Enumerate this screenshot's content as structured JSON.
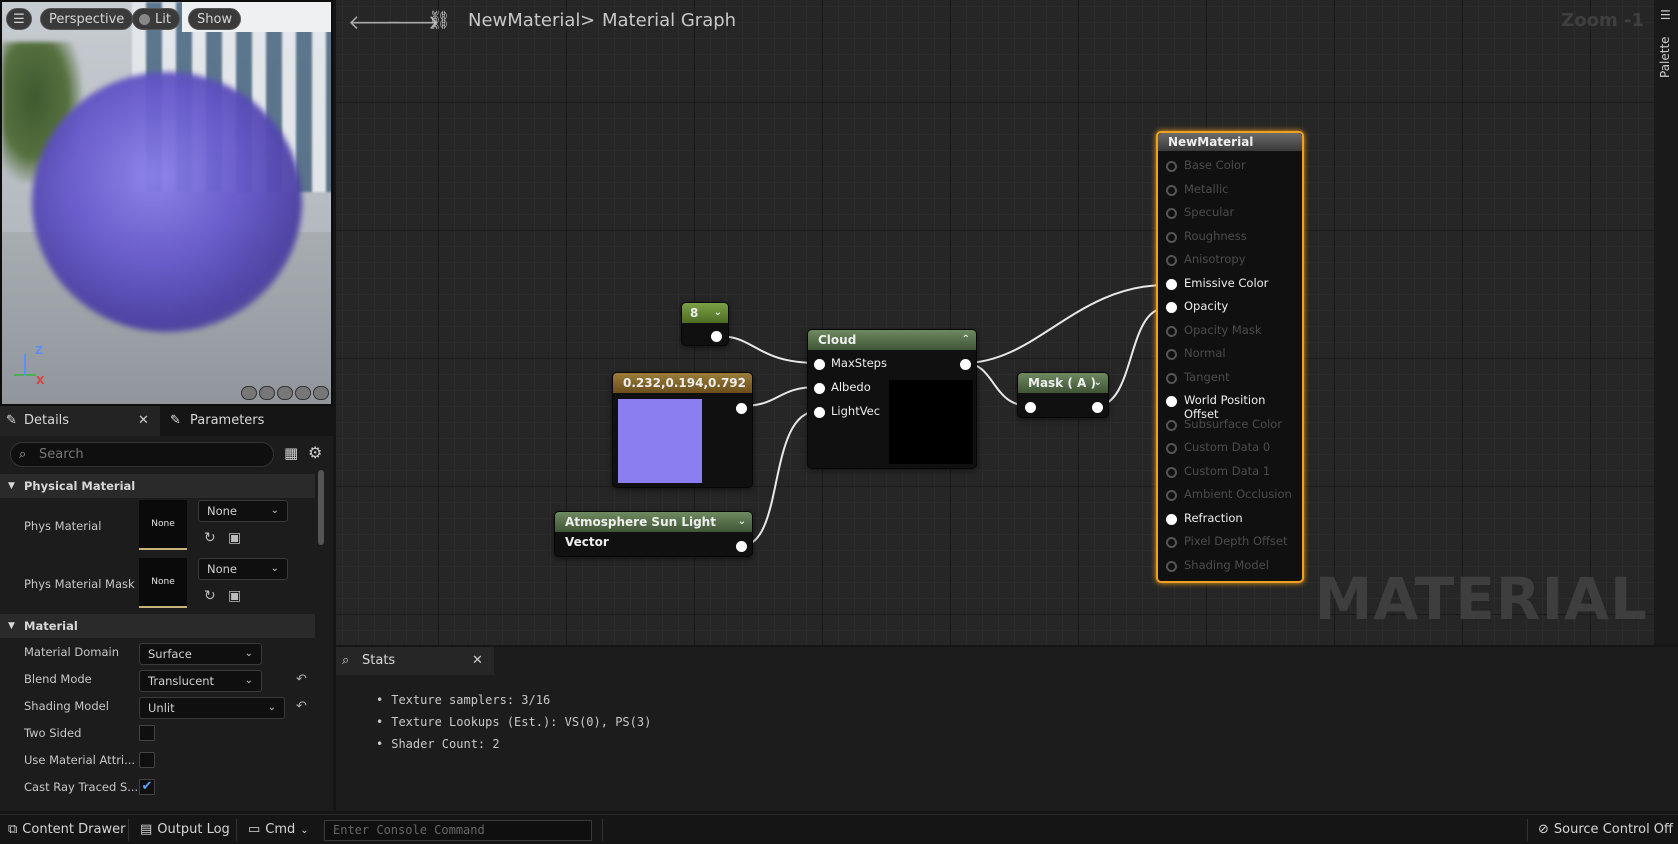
{
  "viewport": {
    "buttons": {
      "perspective": "Perspective",
      "lit": "Lit",
      "show": "Show"
    },
    "axis": {
      "z": "Z",
      "x": "X"
    }
  },
  "details": {
    "tabs": {
      "details": "Details",
      "parameters": "Parameters"
    },
    "search_placeholder": "Search",
    "sections": {
      "physical_material": "Physical Material",
      "material": "Material"
    },
    "props": {
      "phys_material": {
        "label": "Phys Material",
        "thumb": "None",
        "value": "None"
      },
      "phys_material_mask": {
        "label": "Phys Material Mask",
        "thumb": "None",
        "value": "None"
      },
      "material_domain": {
        "label": "Material Domain",
        "value": "Surface"
      },
      "blend_mode": {
        "label": "Blend Mode",
        "value": "Translucent"
      },
      "shading_model": {
        "label": "Shading Model",
        "value": "Unlit"
      },
      "two_sided": {
        "label": "Two Sided",
        "checked": false
      },
      "use_material_attri": {
        "label": "Use Material Attri...",
        "checked": false
      },
      "cast_ray_traced": {
        "label": "Cast Ray Traced S...",
        "checked": true
      }
    }
  },
  "graph": {
    "breadcrumb": {
      "asset": "NewMaterial",
      "separator": ">",
      "graph": "Material Graph"
    },
    "zoom": "Zoom -1",
    "palette": "Palette",
    "watermark": "MATERIAL",
    "nodes": {
      "const8": {
        "title": "8"
      },
      "color": {
        "title": "0.232,0.194,0.792",
        "swatch": "#8b7ef0"
      },
      "sunvec": {
        "title": "Atmosphere Sun Light Vector"
      },
      "cloud": {
        "title": "Cloud",
        "inputs": [
          "MaxSteps",
          "Albedo",
          "LightVec"
        ]
      },
      "mask": {
        "title": "Mask ( A )"
      },
      "result": {
        "title": "NewMaterial",
        "pins": [
          {
            "label": "Base Color",
            "active": false
          },
          {
            "label": "Metallic",
            "active": false
          },
          {
            "label": "Specular",
            "active": false
          },
          {
            "label": "Roughness",
            "active": false
          },
          {
            "label": "Anisotropy",
            "active": false
          },
          {
            "label": "Emissive Color",
            "active": true
          },
          {
            "label": "Opacity",
            "active": true
          },
          {
            "label": "Opacity Mask",
            "active": false
          },
          {
            "label": "Normal",
            "active": false
          },
          {
            "label": "Tangent",
            "active": false
          },
          {
            "label": "World Position Offset",
            "active": true
          },
          {
            "label": "Subsurface Color",
            "active": false
          },
          {
            "label": "Custom Data 0",
            "active": false
          },
          {
            "label": "Custom Data 1",
            "active": false
          },
          {
            "label": "Ambient Occlusion",
            "active": false
          },
          {
            "label": "Refraction",
            "active": true
          },
          {
            "label": "Pixel Depth Offset",
            "active": false
          },
          {
            "label": "Shading Model",
            "active": false
          }
        ]
      }
    }
  },
  "stats": {
    "tab": "Stats",
    "lines": [
      "Texture samplers: 3/16",
      "Texture Lookups (Est.): VS(0), PS(3)",
      "Shader Count: 2"
    ]
  },
  "statusbar": {
    "content_drawer": "Content Drawer",
    "output_log": "Output Log",
    "cmd": "Cmd",
    "console_placeholder": "Enter Console Command",
    "source_control": "Source Control Off"
  },
  "colors": {
    "accent_orange": "#f0a020",
    "node_green": "#5a7a4e",
    "const_header": "#6a8a2a",
    "vector_header": "#8a6a2a"
  }
}
